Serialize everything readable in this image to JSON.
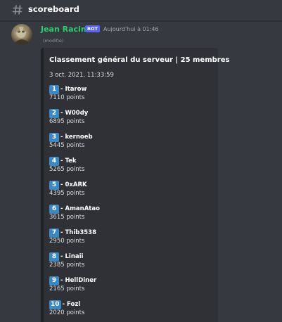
{
  "channel": {
    "name": "scoreboard",
    "icon": "hash-icon"
  },
  "message": {
    "author": "Jean Racine",
    "author_color": "#2ecc71",
    "bot_badge": "BOT",
    "timestamp": "Aujourd'hui à 01:46",
    "edited": "(modifié)"
  },
  "embed": {
    "title": "Classement général du serveur | 25 membres",
    "date": "3 oct. 2021, 11:33:59",
    "entries": [
      {
        "rank": "1",
        "name": "- Itarow",
        "points": "7110 points"
      },
      {
        "rank": "2",
        "name": "- W00dy",
        "points": "6895 points"
      },
      {
        "rank": "3",
        "name": "- kernoeb",
        "points": "5445 points"
      },
      {
        "rank": "4",
        "name": "- Tek",
        "points": "5265 points"
      },
      {
        "rank": "5",
        "name": "- 0xARK",
        "points": "4395 points"
      },
      {
        "rank": "6",
        "name": "- AmanAtao",
        "points": "3615 points"
      },
      {
        "rank": "7",
        "name": "- Thib3538",
        "points": "2950 points"
      },
      {
        "rank": "8",
        "name": "- Linaii",
        "points": "2385 points"
      },
      {
        "rank": "9",
        "name": "- HellDiner",
        "points": "2165 points"
      },
      {
        "rank": "10",
        "name": "- Fozl",
        "points": "2020 points"
      }
    ]
  },
  "colors": {
    "background": "#36393f",
    "embed_background": "#2f3136",
    "embed_border": "#202225",
    "rank_badge": "#3b88c3",
    "bot_badge": "#5865f2"
  }
}
